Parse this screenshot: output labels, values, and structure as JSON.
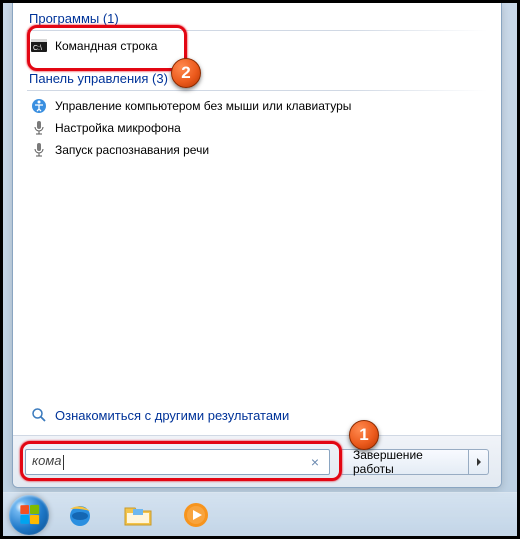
{
  "sections": {
    "programs": {
      "header": "Программы (1)",
      "items": [
        "Командная строка"
      ]
    },
    "control_panel": {
      "header": "Панель управления (3)",
      "items": [
        "Управление компьютером без мыши или клавиатуры",
        "Настройка микрофона",
        "Запуск распознавания речи"
      ]
    }
  },
  "more_results": "Ознакомиться с другими результатами",
  "search": {
    "value": "кома"
  },
  "shutdown": {
    "label": "Завершение работы"
  },
  "annotations": {
    "badge1": "1",
    "badge2": "2"
  }
}
